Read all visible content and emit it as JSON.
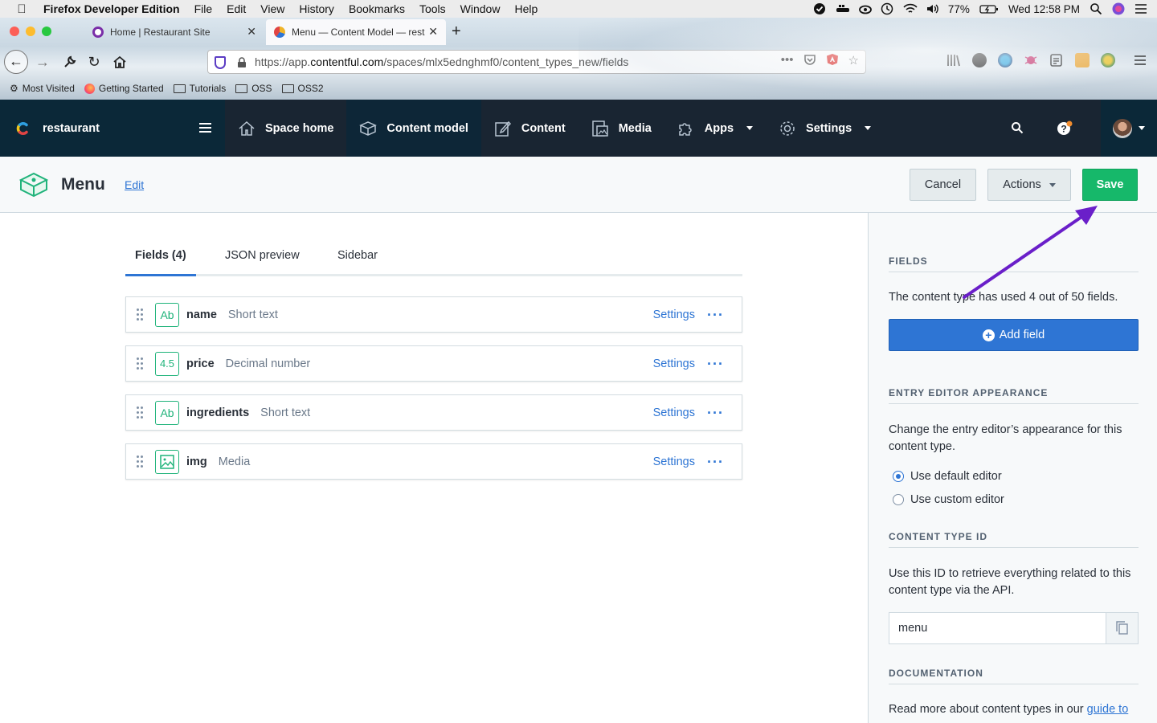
{
  "macbar": {
    "app": "Firefox Developer Edition",
    "menus": [
      "File",
      "Edit",
      "View",
      "History",
      "Bookmarks",
      "Tools",
      "Window",
      "Help"
    ],
    "battery": "77%",
    "clock": "Wed 12:58 PM"
  },
  "browser": {
    "tabs": [
      {
        "title": "Home | Restaurant Site",
        "active": false
      },
      {
        "title": "Menu — Content Model — resta",
        "active": true
      }
    ],
    "url_prefix": "https://app.",
    "url_domain": "contentful.com",
    "url_path": "/spaces/mlx5ednghmf0/content_types_new/fields",
    "bookmarks": [
      "Most Visited",
      "Getting Started",
      "Tutorials",
      "OSS",
      "OSS2"
    ]
  },
  "nav": {
    "space_name": "restaurant",
    "items": [
      {
        "label": "Space home",
        "icon": "home-icon"
      },
      {
        "label": "Content model",
        "icon": "content-model-icon",
        "active": true
      },
      {
        "label": "Content",
        "icon": "content-edit-icon"
      },
      {
        "label": "Media",
        "icon": "media-icon"
      },
      {
        "label": "Apps",
        "icon": "puzzle-icon",
        "dropdown": true
      },
      {
        "label": "Settings",
        "icon": "gear-icon",
        "dropdown": true
      }
    ]
  },
  "header": {
    "title": "Menu",
    "edit_link": "Edit",
    "cancel": "Cancel",
    "actions": "Actions",
    "save": "Save"
  },
  "tabs": [
    {
      "label": "Fields (4)",
      "active": true
    },
    {
      "label": "JSON preview"
    },
    {
      "label": "Sidebar"
    }
  ],
  "fields": [
    {
      "name": "name",
      "type": "Short text",
      "icon_text": "Ab",
      "settings": "Settings",
      "more": "···"
    },
    {
      "name": "price",
      "type": "Decimal number",
      "icon_text": "4.5",
      "settings": "Settings",
      "more": "···"
    },
    {
      "name": "ingredients",
      "type": "Short text",
      "icon_text": "Ab",
      "settings": "Settings",
      "more": "···"
    },
    {
      "name": "img",
      "type": "Media",
      "icon_text": "",
      "settings": "Settings",
      "more": "···"
    }
  ],
  "sidebar": {
    "fields_heading": "FIELDS",
    "fields_text": "The content type has used 4 out of 50 fields.",
    "add_field": "Add field",
    "appearance_heading": "ENTRY EDITOR APPEARANCE",
    "appearance_text": "Change the entry editor’s appearance for this content type.",
    "radio_default": "Use default editor",
    "radio_custom": "Use custom editor",
    "id_heading": "CONTENT TYPE ID",
    "id_text": "Use this ID to retrieve everything related to this content type via the API.",
    "id_value": "menu",
    "doc_heading": "DOCUMENTATION",
    "doc_text": "Read more about content types in our ",
    "doc_link": "guide to"
  },
  "colors": {
    "nav_bg": "#0b2838",
    "save_green": "#16b86a",
    "primary_blue": "#2e75d4",
    "annotation_arrow": "#6a1fc9"
  }
}
